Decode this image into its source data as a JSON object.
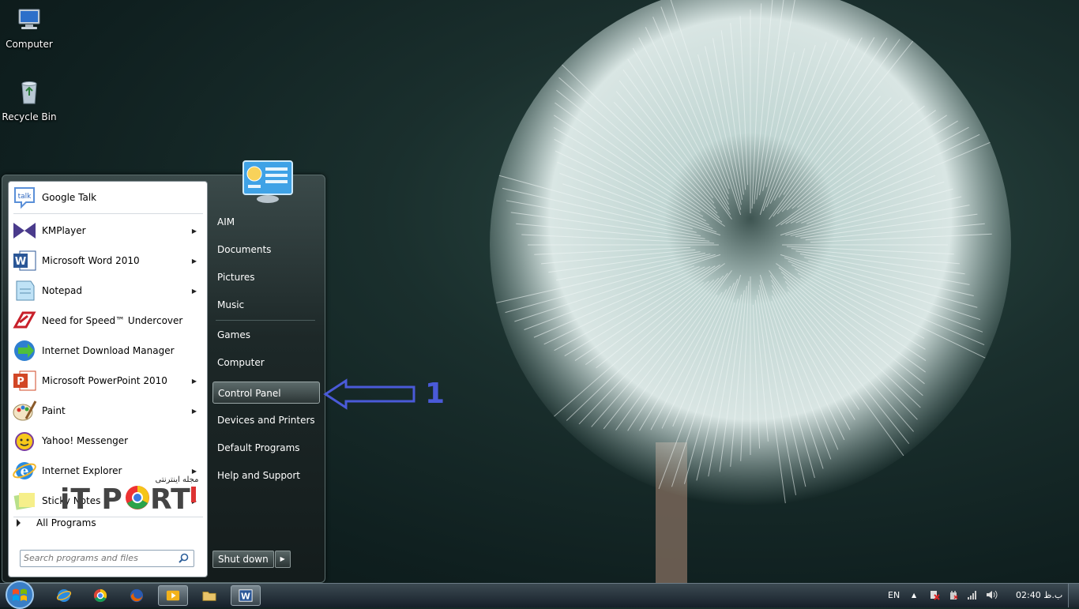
{
  "desktop": {
    "icons": [
      {
        "label": "Computer"
      },
      {
        "label": "Recycle Bin"
      }
    ]
  },
  "start_menu": {
    "pinned": [
      {
        "label": "Google Talk",
        "icon": "google-talk-icon",
        "has_submenu": false
      },
      {
        "label": "KMPlayer",
        "icon": "kmplayer-icon",
        "has_submenu": true
      },
      {
        "label": "Microsoft Word 2010",
        "icon": "word-icon",
        "has_submenu": true
      },
      {
        "label": "Notepad",
        "icon": "notepad-icon",
        "has_submenu": true
      },
      {
        "label": "Need for Speed™ Undercover",
        "icon": "nfs-icon",
        "has_submenu": false
      },
      {
        "label": "Internet Download Manager",
        "icon": "idm-icon",
        "has_submenu": false
      },
      {
        "label": "Microsoft PowerPoint 2010",
        "icon": "powerpoint-icon",
        "has_submenu": true
      },
      {
        "label": "Paint",
        "icon": "paint-icon",
        "has_submenu": true
      },
      {
        "label": "Yahoo! Messenger",
        "icon": "yahoo-messenger-icon",
        "has_submenu": false
      },
      {
        "label": "Internet Explorer",
        "icon": "ie-icon",
        "has_submenu": true
      },
      {
        "label": "Sticky Notes",
        "icon": "sticky-notes-icon",
        "has_submenu": true
      }
    ],
    "all_programs": "All Programs",
    "search": {
      "placeholder": "Search programs and files"
    },
    "right": {
      "items": [
        "AIM",
        "Documents",
        "Pictures",
        "Music",
        "Games",
        "Computer",
        "Control Panel",
        "Devices and Printers",
        "Default Programs",
        "Help and Support"
      ],
      "highlighted": "Control Panel"
    },
    "shutdown_label": "Shut down"
  },
  "annotation": {
    "number": "1",
    "color": "#4a5ad8"
  },
  "watermark": {
    "brand": "iT PORT",
    "tagline": "مجله اینترنتی"
  },
  "taskbar": {
    "apps": [
      "ie-icon",
      "chrome-icon",
      "firefox-icon",
      "media-player-icon",
      "explorer-icon",
      "word-icon"
    ],
    "active_app": "word-icon",
    "language": "EN",
    "clock": "02:40 ب.ظ"
  }
}
